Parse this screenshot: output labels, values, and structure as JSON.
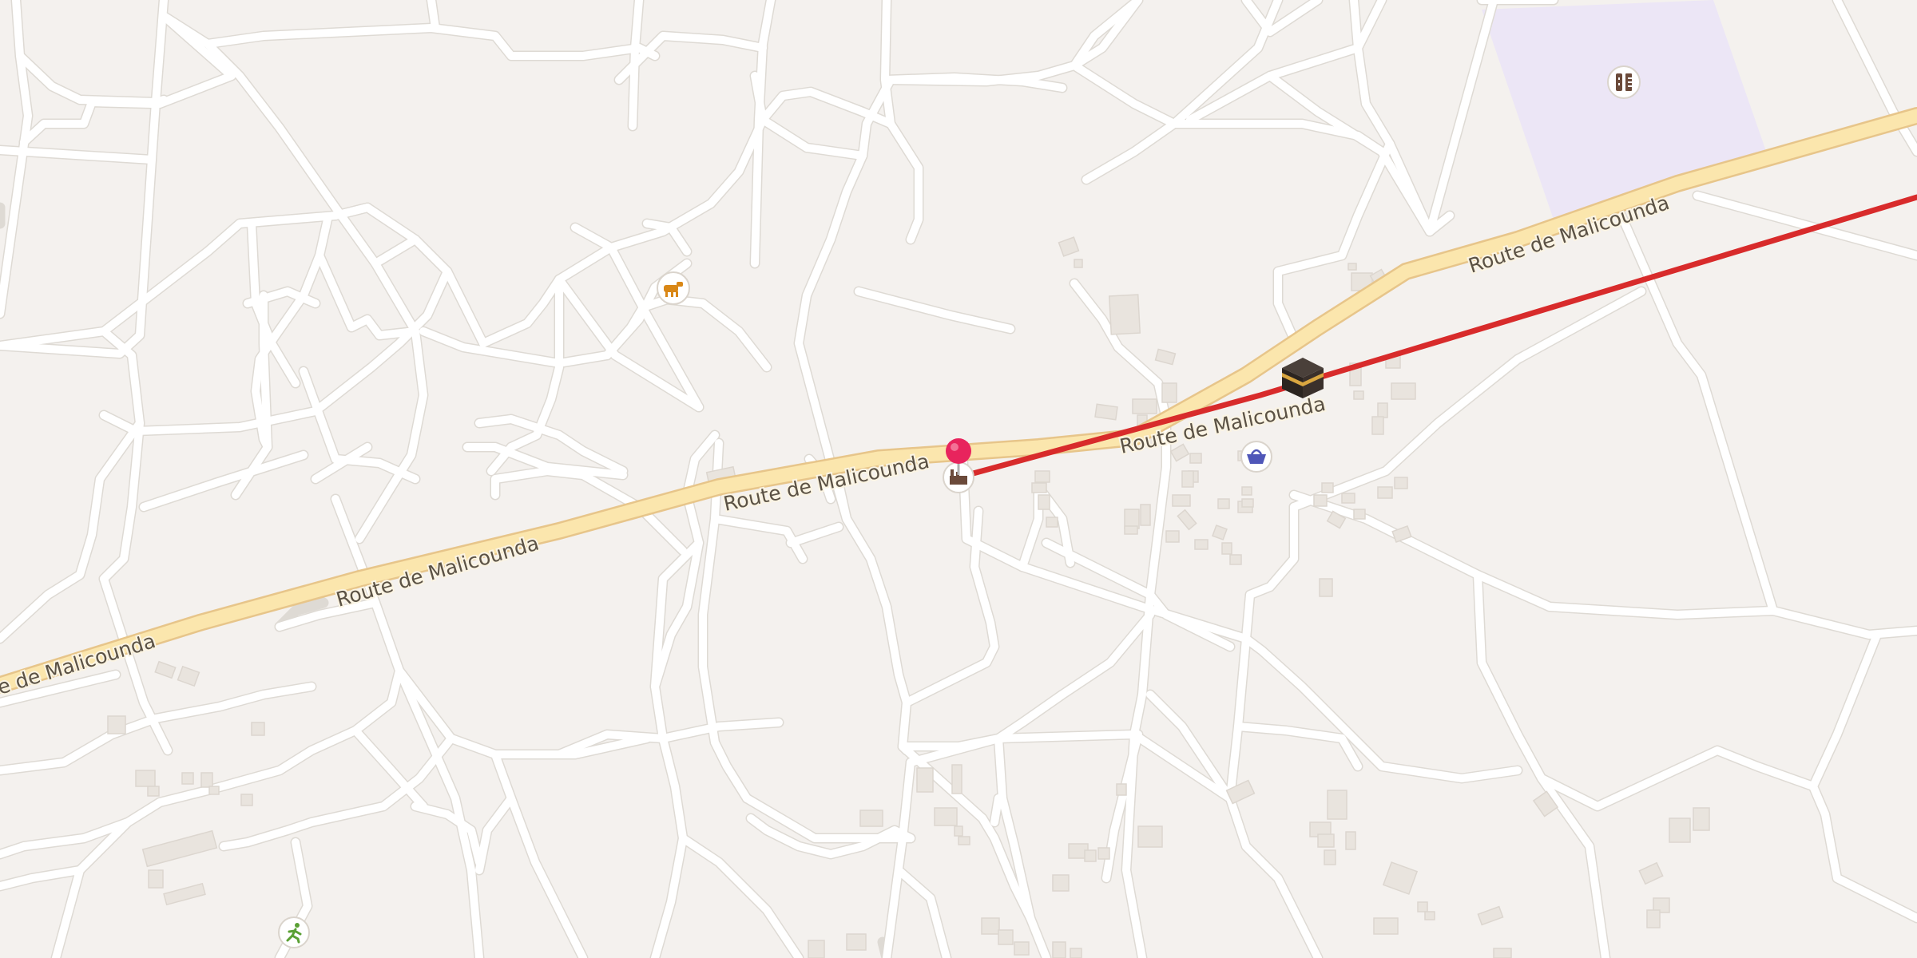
{
  "map": {
    "roads": {
      "primary_name": "Route de Malicounda",
      "labels": [
        "e de Malicounda",
        "Route de Malicounda",
        "Route de Malicounda",
        "Route de Malicounda",
        "Route de Malicounda"
      ]
    },
    "pois": [
      {
        "name": "livestock-market",
        "icon": "cow-icon",
        "color": "#d98716"
      },
      {
        "name": "school",
        "icon": "building-ruler-icon",
        "color": "#6b4a3a"
      },
      {
        "name": "factory",
        "icon": "factory-icon",
        "color": "#6b4a3a"
      },
      {
        "name": "shop",
        "icon": "basket-icon",
        "color": "#4f56b8"
      },
      {
        "name": "sports",
        "icon": "runner-icon",
        "color": "#5aa034"
      },
      {
        "name": "place-of-worship",
        "icon": "kaaba-icon",
        "color": "#2b2420"
      }
    ],
    "marker": {
      "icon": "pin-icon",
      "color": "#e8245d"
    },
    "route": {
      "color": "#d82b2b"
    },
    "landuse_color": "#ece6f6"
  }
}
